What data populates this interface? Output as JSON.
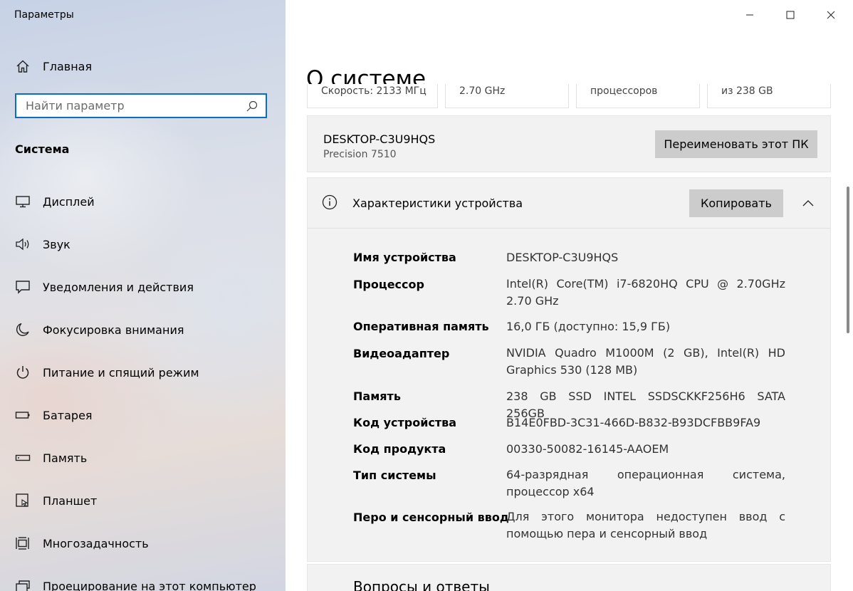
{
  "window": {
    "app_title": "Параметры"
  },
  "sidebar": {
    "home_label": "Главная",
    "search_placeholder": "Найти параметр",
    "section_title": "Система",
    "items": [
      {
        "label": "Дисплей",
        "icon": "display-icon"
      },
      {
        "label": "Звук",
        "icon": "speaker-icon"
      },
      {
        "label": "Уведомления и действия",
        "icon": "notification-icon"
      },
      {
        "label": "Фокусировка внимания",
        "icon": "moon-icon"
      },
      {
        "label": "Питание и спящий режим",
        "icon": "power-icon"
      },
      {
        "label": "Батарея",
        "icon": "battery-icon"
      },
      {
        "label": "Память",
        "icon": "storage-icon"
      },
      {
        "label": "Планшет",
        "icon": "tablet-icon"
      },
      {
        "label": "Многозадачность",
        "icon": "multitasking-icon"
      },
      {
        "label": "Проецирование на этот компьютер",
        "icon": "projecting-icon"
      }
    ]
  },
  "main": {
    "page_title": "О системе",
    "top_cards": [
      "Скорость: 2133 МГц",
      "2.70 GHz",
      "процессоров",
      "из 238 GB"
    ],
    "pc": {
      "name": "DESKTOP-C3U9HQS",
      "model": "Precision 7510",
      "rename_button": "Переименовать этот ПК"
    },
    "specs": {
      "title": "Характеристики устройства",
      "copy_button": "Копировать",
      "rows": [
        {
          "label": "Имя устройства",
          "value": "DESKTOP-C3U9HQS"
        },
        {
          "label": "Процессор",
          "value": "Intel(R) Core(TM) i7-6820HQ CPU @ 2.70GHz 2.70 GHz"
        },
        {
          "label": "Оперативная память",
          "value": "16,0 ГБ (доступно: 15,9 ГБ)"
        },
        {
          "label": "Видеоадаптер",
          "value": "NVIDIA Quadro M1000M (2 GB), Intel(R) HD Graphics 530 (128 MB)"
        },
        {
          "label": "Память",
          "value": "238 GB SSD INTEL SSDSCKKF256H6 SATA 256GB"
        },
        {
          "label": "Код устройства",
          "value": "B14E0FBD-3C31-466D-B832-B93DCFBB9FA9"
        },
        {
          "label": "Код продукта",
          "value": "00330-50082-16145-AAOEM"
        },
        {
          "label": "Тип системы",
          "value": "64-разрядная операционная система, процессор x64"
        },
        {
          "label": "Перо и сенсорный ввод",
          "value": "Для этого монитора недоступен ввод с помощью пера и сенсорный ввод"
        }
      ]
    },
    "faq_title": "Вопросы и ответы"
  },
  "colors": {
    "accent": "#0a6ec8",
    "button_bg": "#cccccc",
    "card_bg": "#f2f2f2"
  }
}
